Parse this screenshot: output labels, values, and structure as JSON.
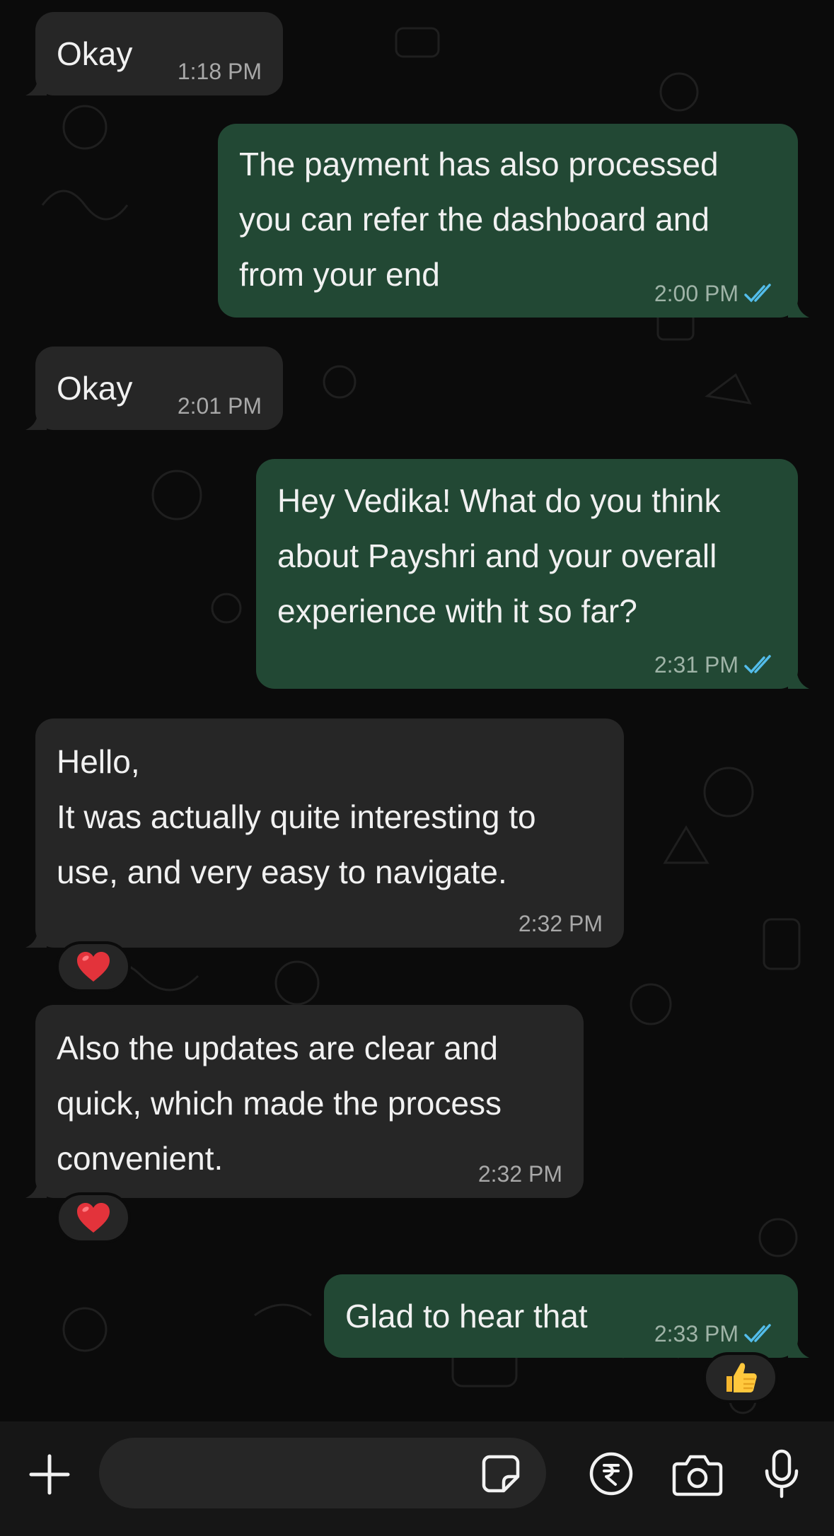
{
  "messages": [
    {
      "side": "in",
      "text": "Okay",
      "time": "1:18 PM"
    },
    {
      "side": "out",
      "text": "The payment has also processed you can refer the dashboard and from your end",
      "time": "2:00 PM",
      "read": true
    },
    {
      "side": "in",
      "text": "Okay",
      "time": "2:01 PM"
    },
    {
      "side": "out",
      "text": "Hey Vedika! What do you think about Payshri and your overall experience with it so far?",
      "time": "2:31 PM",
      "read": true
    },
    {
      "side": "in",
      "text": "Hello,\nIt was actually quite interesting to use, and very easy to navigate.",
      "time": "2:32 PM",
      "reaction": "heart"
    },
    {
      "side": "in",
      "text": "Also the updates are clear and quick, which made the process convenient.",
      "time": "2:32 PM",
      "reaction": "heart"
    },
    {
      "side": "out",
      "text": "Glad to hear that",
      "time": "2:33 PM",
      "read": true,
      "reaction": "thumbs-up"
    }
  ],
  "composer": {
    "placeholder": "",
    "icons": [
      "plus-icon",
      "sticker-icon",
      "rupee-payment-icon",
      "camera-icon",
      "microphone-icon"
    ]
  },
  "colors": {
    "incoming_bubble": "#262626",
    "outgoing_bubble": "#224834",
    "read_ticks": "#53bdeb",
    "background": "#0b0b0b"
  }
}
